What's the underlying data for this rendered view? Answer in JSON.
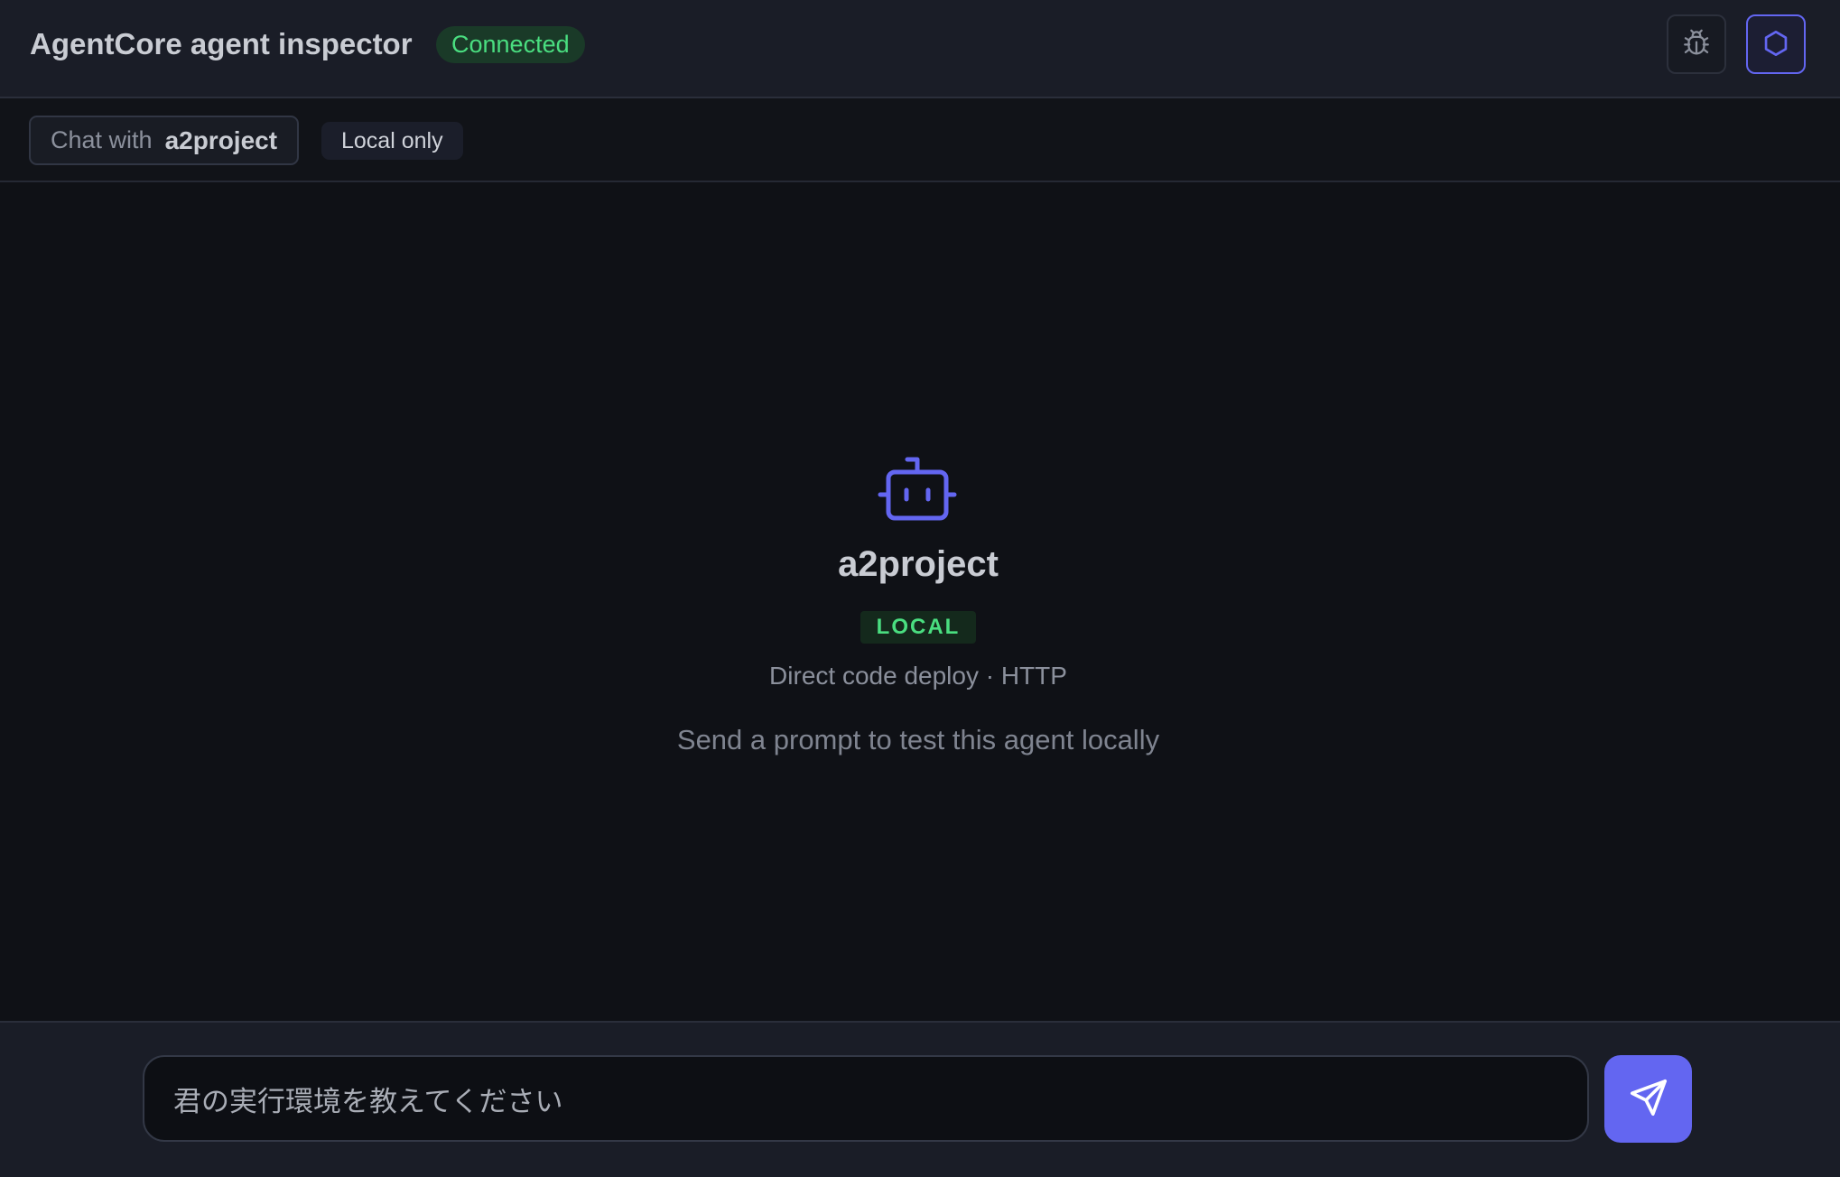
{
  "header": {
    "title": "AgentCore agent inspector",
    "status": "Connected",
    "debug_icon": "bug-icon",
    "agent_icon": "hexagon-icon"
  },
  "subbar": {
    "chat_prefix": "Chat with",
    "agent_name": "a2project",
    "scope": "Local only"
  },
  "empty_state": {
    "icon": "bot-icon",
    "agent_name": "a2project",
    "mode": "LOCAL",
    "deploy_info": "Direct code deploy · HTTP",
    "hint": "Send a prompt to test this agent locally"
  },
  "composer": {
    "input_value": "君の実行環境を教えてください",
    "send_icon": "send-icon"
  },
  "colors": {
    "accent": "#6366f1",
    "success": "#4ade80",
    "header_bg": "#1a1d27",
    "main_bg": "#0f1116"
  }
}
